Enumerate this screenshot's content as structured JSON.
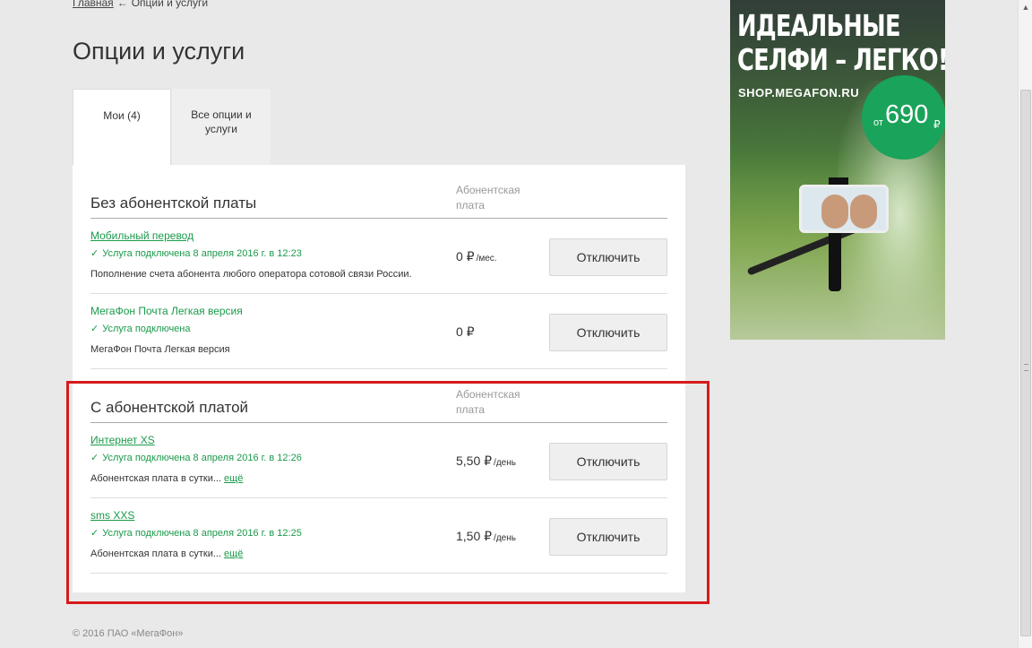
{
  "breadcrumb": {
    "home": "Главная",
    "arrow": "←",
    "current": "Опции и услуги"
  },
  "page_title": "Опции и услуги",
  "tabs": [
    {
      "label": "Мои (4)",
      "active": true
    },
    {
      "label": "Все опции и услуги",
      "active": false
    }
  ],
  "sections": [
    {
      "title": "Без абонентской платы",
      "fee_header": "Абонентская плата",
      "rows": [
        {
          "name": "Мобильный перевод",
          "status": "Услуга подключена 8 апреля 2016 г. в 12:23",
          "description": "Пополнение счета абонента любого оператора сотовой связи России.",
          "more": "",
          "price": "0 ₽",
          "unit": "/мес.",
          "button": "Отключить"
        },
        {
          "name": "МегаФон Почта Легкая версия",
          "status": "Услуга подключена",
          "description": "МегаФон Почта Легкая версия",
          "more": "",
          "price": "0 ₽",
          "unit": "",
          "button": "Отключить"
        }
      ]
    },
    {
      "title": "С абонентской платой",
      "fee_header": "Абонентская плата",
      "rows": [
        {
          "name": "Интернет XS",
          "status": "Услуга подключена 8 апреля 2016 г. в 12:26",
          "description": "Абонентская плата в сутки...",
          "more": "ещё",
          "price": "5,50 ₽",
          "unit": "/день",
          "button": "Отключить"
        },
        {
          "name": "sms XXS",
          "status": "Услуга подключена 8 апреля 2016 г. в 12:25",
          "description": "Абонентская плата в сутки...",
          "more": "ещё",
          "price": "1,50 ₽",
          "unit": "/день",
          "button": "Отключить"
        }
      ]
    }
  ],
  "footer": "© 2016 ПАО «МегаФон»",
  "ad": {
    "headline_1": "ИДЕАЛЬНЫЕ",
    "headline_2": "СЕЛФИ – ЛЕГКО!",
    "url": "SHOP.MEGAFON.RU",
    "price_from": "от",
    "price_amount": "690",
    "price_currency": "₽"
  },
  "colors": {
    "accent_green": "#1a9a4a",
    "highlight_red": "#d61a1a",
    "badge_green": "#1aa35a"
  },
  "icons": {
    "check": "✓",
    "scroll_up": "▲"
  }
}
